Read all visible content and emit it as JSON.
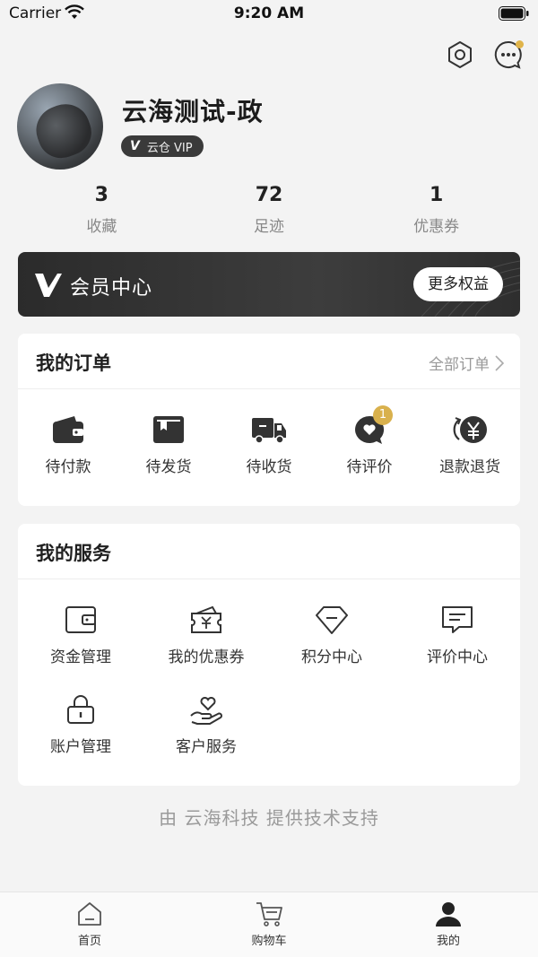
{
  "status_bar": {
    "carrier": "Carrier",
    "time": "9:20 AM"
  },
  "header_icons": [
    "settings-icon",
    "message-icon"
  ],
  "profile": {
    "username": "云海测试-政",
    "vip_badge": "云仓 VIP",
    "vip_mark": "V"
  },
  "stats": [
    {
      "value": "3",
      "label": "收藏"
    },
    {
      "value": "72",
      "label": "足迹"
    },
    {
      "value": "1",
      "label": "优惠券"
    }
  ],
  "member": {
    "title": "会员中心",
    "button": "更多权益"
  },
  "orders": {
    "title": "我的订单",
    "more": "全部订单",
    "items": [
      {
        "label": "待付款",
        "icon": "wallet-icon"
      },
      {
        "label": "待发货",
        "icon": "box-icon"
      },
      {
        "label": "待收货",
        "icon": "truck-icon"
      },
      {
        "label": "待评价",
        "icon": "review-icon",
        "badge": "1"
      },
      {
        "label": "退款退货",
        "icon": "refund-icon"
      }
    ]
  },
  "services": {
    "title": "我的服务",
    "items": [
      {
        "label": "资金管理",
        "icon": "wallet-outline-icon"
      },
      {
        "label": "我的优惠券",
        "icon": "coupon-icon"
      },
      {
        "label": "积分中心",
        "icon": "diamond-icon"
      },
      {
        "label": "评价中心",
        "icon": "comment-icon"
      },
      {
        "label": "账户管理",
        "icon": "lock-icon"
      },
      {
        "label": "客户服务",
        "icon": "heart-hand-icon"
      }
    ]
  },
  "footer_note": "由 云海科技 提供技术支持",
  "tabs": [
    {
      "label": "首页",
      "icon": "home-icon"
    },
    {
      "label": "购物车",
      "icon": "cart-icon"
    },
    {
      "label": "我的",
      "icon": "user-icon"
    }
  ],
  "colors": {
    "accent": "#d9b14d",
    "dark_card": "#333333",
    "background": "#f3f3f3"
  }
}
